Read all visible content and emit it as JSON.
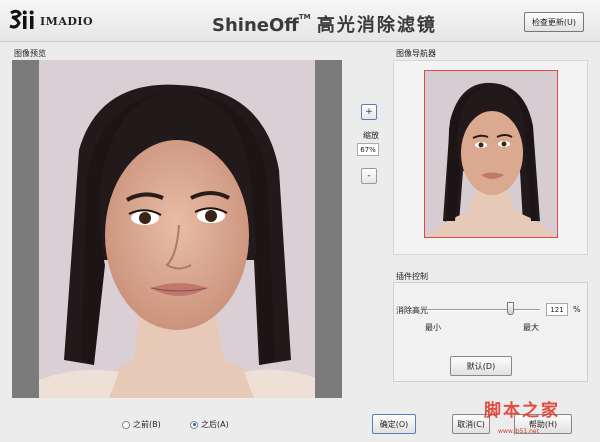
{
  "header": {
    "logo_text": "IMADIO",
    "title_main": "ShineOff",
    "title_tm": "TM",
    "title_cn": "高光消除滤镜",
    "update_button": "检查更新(U)"
  },
  "preview": {
    "label": "图像预览"
  },
  "zoom": {
    "in_symbol": "+",
    "label": "缩放",
    "value": "67%",
    "out_symbol": "-"
  },
  "navigator": {
    "label": "图像导航器"
  },
  "plugin": {
    "label": "插件控制",
    "param_label": "消除高光",
    "min_label": "最小",
    "max_label": "最大",
    "value": "121",
    "unit": "%",
    "slider_level_percent": 73,
    "default_button": "默认(D)"
  },
  "compare": {
    "before_label": "之前(B)",
    "after_label": "之后(A)",
    "selected": "after"
  },
  "footer": {
    "ok_button": "确定(O)",
    "cancel_button": "取消(C)",
    "help_button": "帮助(H)"
  },
  "watermark": {
    "main": "脚本之家",
    "url": "www.jb51.net"
  },
  "colors": {
    "preview_bg": "#7b7b7b",
    "nav_frame": "#e04848",
    "accent": "#2d62b8",
    "watermark": "#e03c2e"
  }
}
